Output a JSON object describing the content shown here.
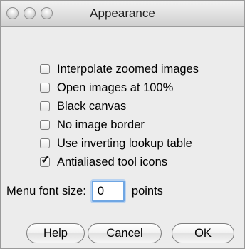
{
  "window": {
    "title": "Appearance"
  },
  "options": [
    {
      "label": "Interpolate zoomed images",
      "checked": false
    },
    {
      "label": "Open images at 100%",
      "checked": false
    },
    {
      "label": "Black canvas",
      "checked": false
    },
    {
      "label": "No image border",
      "checked": false
    },
    {
      "label": "Use inverting lookup table",
      "checked": false
    },
    {
      "label": "Antialiased tool icons",
      "checked": true
    }
  ],
  "font_size": {
    "label": "Menu font size:",
    "value": "0",
    "units": "points"
  },
  "buttons": {
    "help": "Help",
    "cancel": "Cancel",
    "ok": "OK"
  },
  "colors": {
    "background": "#ececec",
    "focus_ring": "#6fa6e3"
  }
}
